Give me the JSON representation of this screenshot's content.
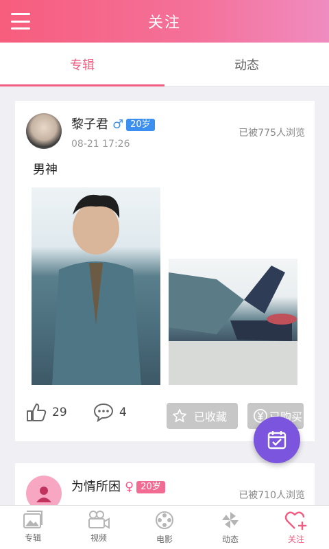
{
  "header": {
    "title": "关注"
  },
  "tabs": [
    {
      "label": "专辑",
      "active": true
    },
    {
      "label": "动态",
      "active": false
    }
  ],
  "posts": [
    {
      "username": "黎子君",
      "gender": "♂",
      "age": "20岁",
      "time": "08-21 17:26",
      "views": "已被775人浏览",
      "text": "男神",
      "likes": "29",
      "comments": "4",
      "fav_label": "已收藏",
      "buy_label": "已购买"
    },
    {
      "username": "为情所困",
      "gender": "♀",
      "age": "20岁",
      "views": "已被710人浏览"
    }
  ],
  "bottom_nav": [
    {
      "label": "专辑",
      "icon": "album-icon",
      "active": false
    },
    {
      "label": "视频",
      "icon": "video-camera-icon",
      "active": false
    },
    {
      "label": "电影",
      "icon": "film-reel-icon",
      "active": false
    },
    {
      "label": "动态",
      "icon": "pinwheel-icon",
      "active": false
    },
    {
      "label": "关注",
      "icon": "heart-plus-icon",
      "active": true
    }
  ],
  "colors": {
    "accent": "#f25a80",
    "header_start": "#f75d7d",
    "header_end": "#f08cc0",
    "fab": "#7b55de"
  }
}
